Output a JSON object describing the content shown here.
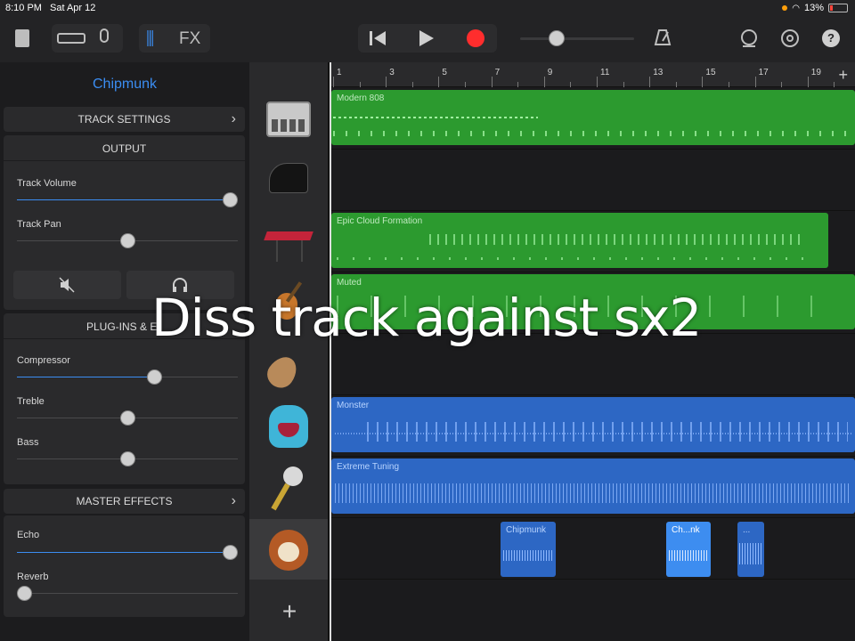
{
  "status": {
    "time": "8:10 PM",
    "date": "Sat Apr 12",
    "battery": "13%"
  },
  "toolbar": {
    "fx_label": "FX"
  },
  "panel": {
    "title": "Chipmunk",
    "track_settings": "TRACK SETTINGS",
    "output": "OUTPUT",
    "track_volume": "Track Volume",
    "track_pan": "Track Pan",
    "plugins": "PLUG-INS & E",
    "compressor": "Compressor",
    "treble": "Treble",
    "bass": "Bass",
    "master_effects": "MASTER EFFECTS",
    "echo": "Echo",
    "reverb": "Reverb",
    "levels": {
      "track_volume": 1.0,
      "track_pan": 0.5,
      "compressor": 0.63,
      "treble": 0.5,
      "bass": 0.5,
      "echo": 1.0,
      "reverb": 0.0
    }
  },
  "ruler": {
    "ticks": [
      "1",
      "3",
      "5",
      "7",
      "9",
      "11",
      "13",
      "15",
      "17",
      "19"
    ],
    "add": "+"
  },
  "regions": {
    "r1": "Modern 808",
    "r2": "Epic Cloud Formation",
    "r3": "Muted",
    "r4": "Monster",
    "r5": "Extreme Tuning",
    "r6": "Chipmunk",
    "r7": "Ch...nk",
    "r8": "..."
  },
  "overlay": "Diss track against sx2",
  "add_track": "+",
  "colors": {
    "accent": "#3b8df2",
    "record": "#ff2d2d",
    "green_region": "#2c9a2f",
    "blue_region": "#2d67c4"
  }
}
